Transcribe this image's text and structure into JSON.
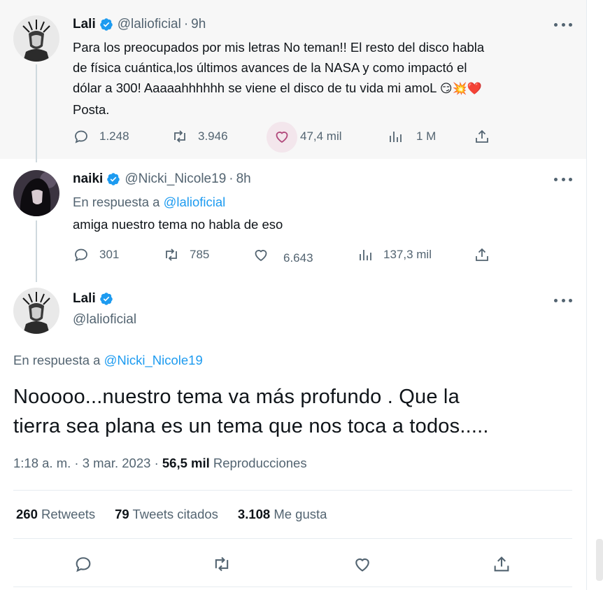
{
  "tweets": [
    {
      "name": "Lali",
      "handle": "@lalioficial",
      "time": "9h",
      "text_line1": "Para los preocupados por mis letras No teman!! El resto del disco habla",
      "text_line2": "de física cuántica,los últimos avances de la NASA y como impactó el",
      "text_line3": "dólar a 300! Aaaaahhhhhh se viene el disco de tu vida mi amoL",
      "text_emojis": "😏💥❤️",
      "text_line4": "Posta.",
      "replies": "1.248",
      "retweets": "3.946",
      "likes": "47,4 mil",
      "views": "1 M"
    },
    {
      "name": "naiki",
      "handle": "@Nicki_Nicole19",
      "time": "8h",
      "reply_prefix": "En respuesta a",
      "reply_to": "@lalioficial",
      "text": "amiga nuestro tema no habla de eso",
      "replies": "301",
      "retweets": "785",
      "likes": "6.643",
      "views": "137,3 mil"
    }
  ],
  "main_tweet": {
    "name": "Lali",
    "handle": "@lalioficial",
    "reply_prefix": "En respuesta a",
    "reply_to": "@Nicki_Nicole19",
    "text_line1": "Nooooo...nuestro tema va más profundo . Que la",
    "text_line2": "tierra sea plana es un tema que nos toca a todos.....",
    "time": "1:18 a. m.",
    "date": "3 mar. 2023",
    "views_count": "56,5 mil",
    "views_label": "Reproducciones",
    "retweets_count": "260",
    "retweets_label": "Retweets",
    "quotes_count": "79",
    "quotes_label": "Tweets citados",
    "likes_count": "3.108",
    "likes_label": "Me gusta"
  },
  "colors": {
    "accent": "#1d9bf0",
    "secondary_text": "#536471",
    "highlight_bg": "#f7f7f7"
  },
  "icons": [
    "verified-badge-icon",
    "more-icon",
    "reply-icon",
    "retweet-icon",
    "like-icon",
    "views-icon",
    "share-icon"
  ]
}
